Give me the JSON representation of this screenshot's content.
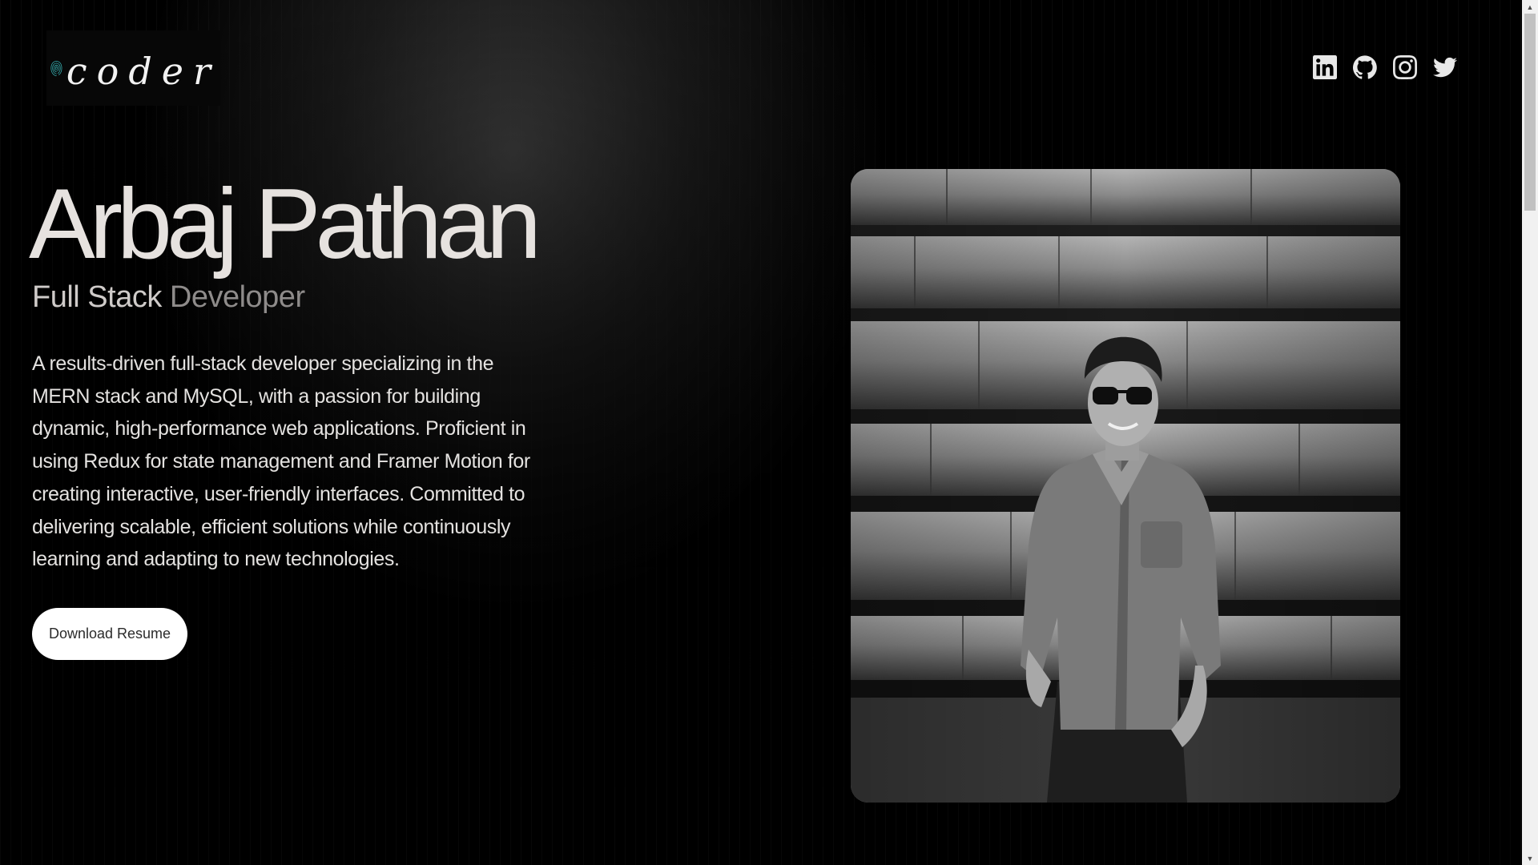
{
  "logo": {
    "text": "coder",
    "icon": "fingerprint-icon",
    "accent_color": "#3ec7c9"
  },
  "social": [
    {
      "name": "LinkedIn",
      "icon": "linkedin-icon"
    },
    {
      "name": "GitHub",
      "icon": "github-icon"
    },
    {
      "name": "Instagram",
      "icon": "instagram-icon"
    },
    {
      "name": "Twitter",
      "icon": "twitter-icon"
    }
  ],
  "hero": {
    "name": "Arbaj Pathan",
    "role_part1": "Full Stack ",
    "role_part2": "Developer",
    "bio": "A results-driven full-stack developer specializing in the MERN stack and MySQL, with a passion for building dynamic, high-performance web applications. Proficient in using Redux for state management and Framer Motion for creating interactive, user-friendly interfaces. Committed to delivering scalable, efficient solutions while continuously learning and adapting to new technologies.",
    "button_label": "Download Resume"
  },
  "colors": {
    "background": "#000000",
    "heading": "#e6e2df",
    "button_bg": "#ffffff"
  }
}
